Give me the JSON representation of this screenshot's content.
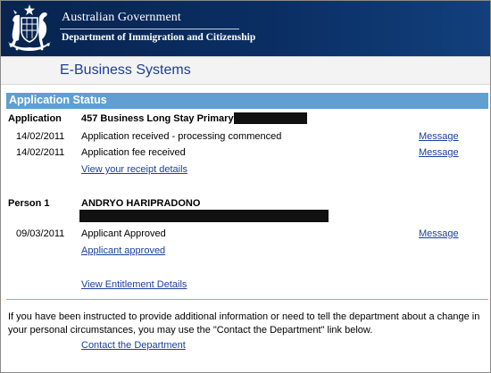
{
  "header": {
    "government": "Australian Government",
    "department": "Department of Immigration and Citizenship",
    "crest_icon": "coat-of-arms-icon"
  },
  "system_title": "E-Business Systems",
  "application_status": {
    "section_title": "Application Status",
    "application": {
      "label": "Application",
      "name": "457 Business Long Stay Primary -",
      "events": [
        {
          "date": "14/02/2011",
          "description": "Application received - processing commenced",
          "action": "Message"
        },
        {
          "date": "14/02/2011",
          "description": "Application fee received",
          "action": "Message"
        }
      ],
      "receipt_link": "View your receipt details"
    },
    "person": {
      "label": "Person 1",
      "name": "ANDRYO HARIPRADONO",
      "events": [
        {
          "date": "09/03/2011",
          "description": "Applicant Approved",
          "action": "Message"
        }
      ],
      "approved_link": "Applicant approved"
    },
    "entitlement_link": "View Entitlement Details"
  },
  "footer": {
    "notice": "If you have been instructed to provide additional information or need to tell the department about a change in your personal circumstances, you may use the \"Contact the Department\" link below.",
    "contact_link": "Contact the Department"
  },
  "colors": {
    "header_bg": "#0a2e63",
    "section_bar": "#5f9fd1",
    "link": "#1a3f9e",
    "title_blue": "#1d3f8f"
  }
}
